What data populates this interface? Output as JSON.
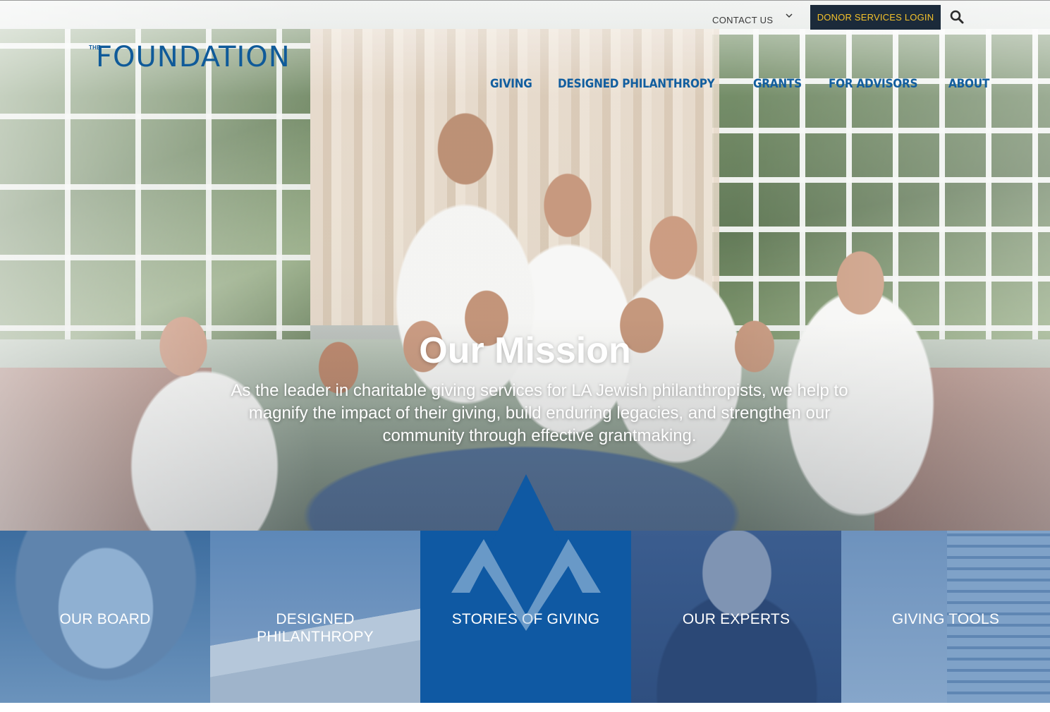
{
  "header": {
    "contact_label": "CONTACT US",
    "donor_login_label": "DONOR SERVICES LOGIN",
    "logo_small": "THE",
    "logo_word": "FOUNDATION"
  },
  "nav": {
    "items": [
      "GIVING",
      "DESIGNED PHILANTHROPY",
      "GRANTS",
      "FOR ADVISORS",
      "ABOUT"
    ]
  },
  "mission": {
    "title": "Our Mission",
    "text": "As the leader in charitable giving services for LA Jewish philanthropists, we help to magnify the impact of their giving, build enduring legacies, and strengthen our community through effective grantmaking."
  },
  "tiles": [
    {
      "label": "OUR BOARD"
    },
    {
      "label": "DESIGNED PHILANTHROPY"
    },
    {
      "label": "STORIES OF GIVING"
    },
    {
      "label": "OUR EXPERTS"
    },
    {
      "label": "GIVING TOOLS"
    }
  ],
  "colors": {
    "brand_blue": "#0f59a3",
    "donor_button_bg": "#1b2a3a",
    "donor_button_text": "#f3c12b"
  },
  "icons": [
    "chevron-down-icon",
    "search-icon",
    "foundation-logo",
    "brand-mark-icon"
  ]
}
